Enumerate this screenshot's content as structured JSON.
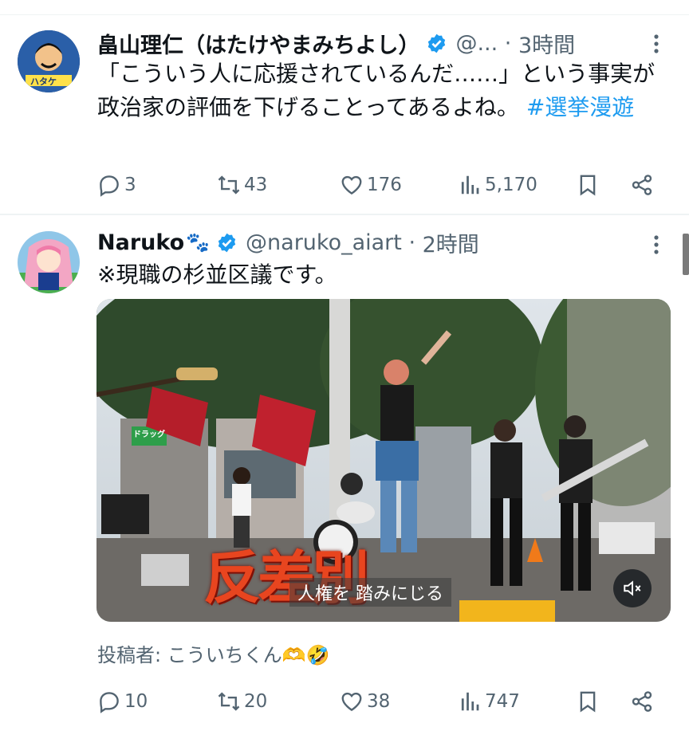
{
  "tweets": [
    {
      "display_name": "畠山理仁（はたけやまみちよし）",
      "handle": "@...",
      "time": "3時間",
      "avatar_text": "ハタケ",
      "text": "「こういう人に応援されているんだ……」という事実が政治家の評価を下げることってあるよね。",
      "hashtag": "#選挙漫遊",
      "stats": {
        "replies": "3",
        "reposts": "43",
        "likes": "176",
        "views": "5,170"
      }
    },
    {
      "display_name": "Naruko",
      "name_emoji": "🐾",
      "handle": "@naruko_aiart",
      "time": "2時間",
      "text": "※現職の杉並区議です。",
      "video": {
        "caption_large": "反差別",
        "caption_small": "人権を 踏みにじる",
        "shop_sign": "ドラッグ"
      },
      "posted_by": "投稿者: こういちくん🫶🤣",
      "stats": {
        "replies": "10",
        "reposts": "20",
        "likes": "38",
        "views": "747"
      }
    }
  ],
  "colors": {
    "accent": "#1d9bf0",
    "secondary": "#536471",
    "divider": "#eff3f4"
  },
  "icons": [
    "verified-badge-icon",
    "more-icon",
    "reply-icon",
    "repost-icon",
    "like-icon",
    "views-icon",
    "bookmark-icon",
    "share-icon",
    "mute-icon"
  ]
}
